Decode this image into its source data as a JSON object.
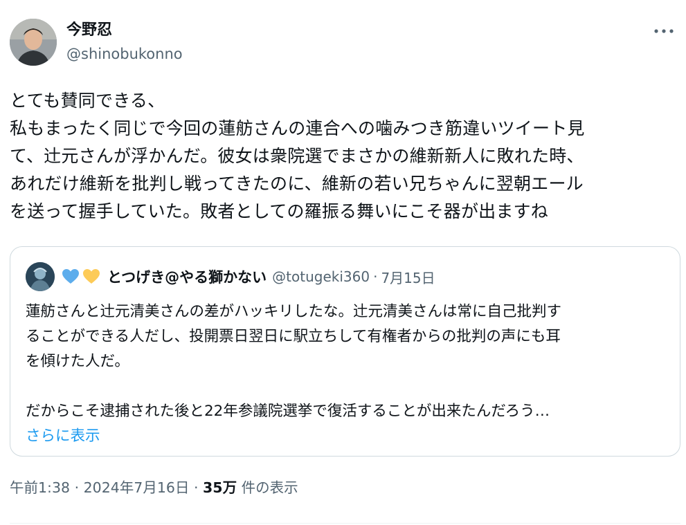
{
  "author": {
    "display_name": "今野忍",
    "handle": "@shinobukonno",
    "avatar_icon": "user-avatar"
  },
  "more_icon": "more-horizontal-icon",
  "tweet": {
    "lines": [
      "とても賛同できる、",
      "私もまったく同じで今回の蓮舫さんの連合への噛みつき筋違いツイート見",
      "て、辻元さんが浮かんだ。彼女は衆院選でまさかの維新新人に敗れた時、",
      "あれだけ維新を批判し戦ってきたのに、維新の若い兄ちゃんに翌朝エール",
      "を送って握手していた。敗者としての羅振る舞いにこそ器が出ますね"
    ]
  },
  "quote": {
    "name": "とつげき@やる獅かない",
    "heart_icons": [
      "blue-heart-icon",
      "yellow-heart-icon"
    ],
    "colors": {
      "blue_heart": "#5dadec",
      "yellow_heart": "#fdcb58"
    },
    "handle": "@totugeki360",
    "separator": "·",
    "date": "7月15日",
    "lines": [
      "蓮舫さんと辻元清美さんの差がハッキリしたな。辻元清美さんは常に自己批判す",
      "ることができる人だし、投開票日翌日に駅立ちして有権者からの批判の声にも耳",
      "を傾けた人だ。",
      "",
      "だからこそ逮捕された後と22年参議院選挙で復活することが出来たんだろう…"
    ],
    "show_more": "さらに表示"
  },
  "footer": {
    "time": "午前1:38",
    "sep1": "·",
    "date": "2024年7月16日",
    "sep2": "·",
    "views_count": "35万",
    "views_label": "件の表示"
  },
  "colors": {
    "text": "#0f1419",
    "secondary": "#536471",
    "link": "#1d9bf0",
    "border": "#cfd9de"
  }
}
